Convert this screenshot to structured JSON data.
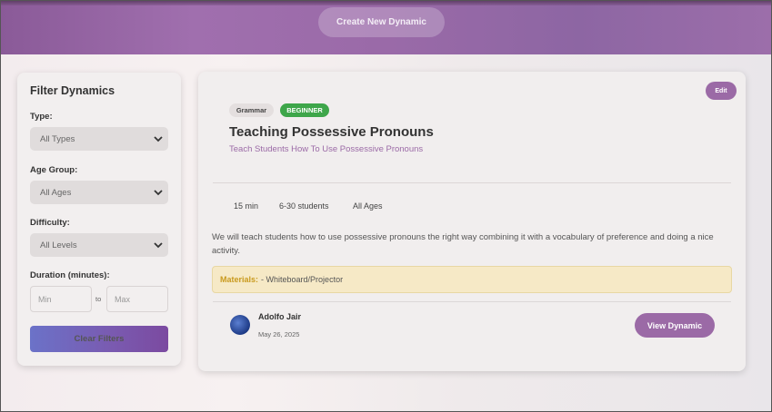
{
  "header": {
    "create_label": "Create New Dynamic"
  },
  "filters": {
    "title": "Filter Dynamics",
    "type": {
      "label": "Type:",
      "value": "All Types"
    },
    "age_group": {
      "label": "Age Group:",
      "value": "All Ages"
    },
    "difficulty": {
      "label": "Difficulty:",
      "value": "All Levels"
    },
    "duration": {
      "label": "Duration (minutes):",
      "min_placeholder": "Min",
      "to_label": "to",
      "max_placeholder": "Max"
    },
    "clear_label": "Clear Filters"
  },
  "card": {
    "edit_label": "Edit",
    "category": "Grammar",
    "level": "BEGINNER",
    "title": "Teaching Possessive Pronouns",
    "subtitle": "Teach Students How To Use Possessive Pronouns",
    "duration": "15 min",
    "students": "6-30 students",
    "ages": "All Ages",
    "description": "We will teach students how to use possessive pronouns the right way combining it with a vocabulary of preference and doing a nice activity.",
    "materials_label": "Materials:",
    "materials_value": "- Whiteboard/Projector",
    "author": "Adolfo Jair",
    "date": "May 26, 2025",
    "view_label": "View Dynamic"
  },
  "colors": {
    "accent": "#9b6aa6",
    "level_badge": "#3ea64a",
    "materials_bg": "#f6e9c6"
  }
}
